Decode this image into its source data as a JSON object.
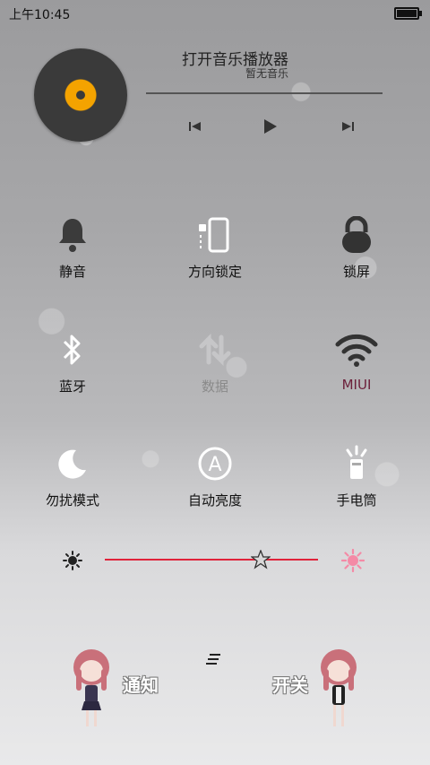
{
  "status_bar": {
    "time": "上午10:45"
  },
  "music": {
    "title": "打开音乐播放器",
    "subtitle": "暂无音乐",
    "disc_color": "#f4a300"
  },
  "toggles": [
    {
      "label": "静音",
      "icon": "bell-icon",
      "state": "off"
    },
    {
      "label": "方向锁定",
      "icon": "rotation-lock-icon",
      "state": "off"
    },
    {
      "label": "锁屏",
      "icon": "lock-icon",
      "state": "off"
    },
    {
      "label": "蓝牙",
      "icon": "bluetooth-icon",
      "state": "off"
    },
    {
      "label": "数据",
      "icon": "data-icon",
      "state": "disabled"
    },
    {
      "label": "MIUI",
      "icon": "wifi-icon",
      "state": "on"
    },
    {
      "label": "勿扰模式",
      "icon": "moon-icon",
      "state": "off"
    },
    {
      "label": "自动亮度",
      "icon": "auto-brightness-icon",
      "state": "off"
    },
    {
      "label": "手电筒",
      "icon": "flashlight-icon",
      "state": "off"
    }
  ],
  "brightness": {
    "level": 0.73,
    "track_color": "#e0233a"
  },
  "bottom_tabs": {
    "notify": "通知",
    "switch": "开关"
  }
}
